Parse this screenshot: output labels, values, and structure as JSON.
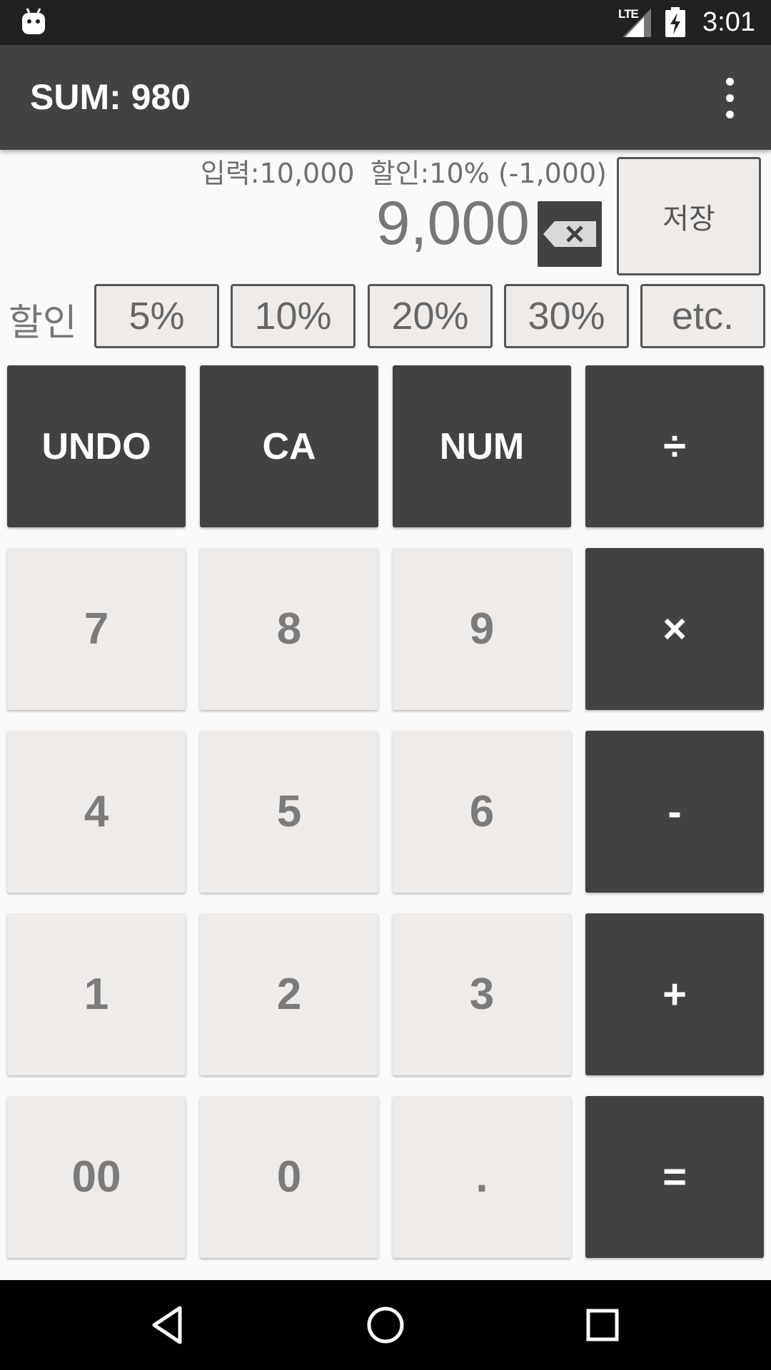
{
  "status_bar": {
    "network": "LTE",
    "time": "3:01"
  },
  "app_bar": {
    "title": "SUM: 980",
    "menu_icon": "more-vert-icon"
  },
  "display": {
    "input_text": "입력:10,000",
    "discount_text": "할인:10% (-1,000)",
    "result": "9,000",
    "backspace_icon": "backspace-icon",
    "save_label": "저장"
  },
  "discount": {
    "label": "할인",
    "options": [
      "5%",
      "10%",
      "20%",
      "30%",
      "etc."
    ]
  },
  "keypad": {
    "undo": "UNDO",
    "ca": "CA",
    "num": "NUM",
    "divide": "÷",
    "seven": "7",
    "eight": "8",
    "nine": "9",
    "multiply": "×",
    "four": "4",
    "five": "5",
    "six": "6",
    "minus": "-",
    "one": "1",
    "two": "2",
    "three": "3",
    "plus": "+",
    "double_zero": "00",
    "zero": "0",
    "dot": ".",
    "equals": "="
  },
  "colors": {
    "app_bar": "#424242",
    "dark_key": "#424242",
    "light_key": "#eeebe9",
    "status_bar": "#212121",
    "nav_bar": "#000000"
  }
}
